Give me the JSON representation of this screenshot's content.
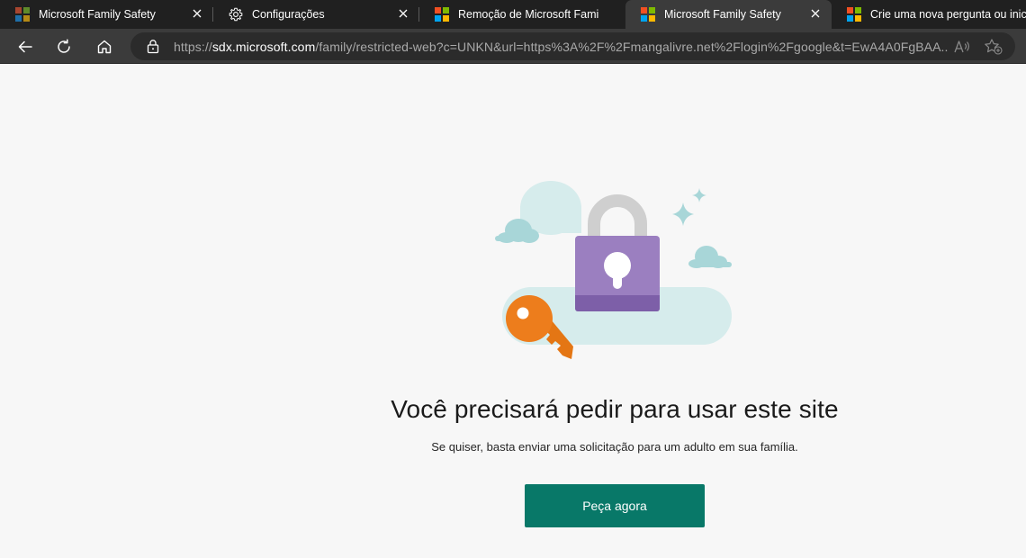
{
  "browser": {
    "tabs": [
      {
        "title": "Microsoft Family Safety",
        "icon": "microsoft-logo-icon",
        "active": false
      },
      {
        "title": "Configurações",
        "icon": "gear-icon",
        "active": false
      },
      {
        "title": "Remoção de Microsoft Family Safety",
        "icon": "microsoft-logo-icon",
        "active": false
      },
      {
        "title": "Microsoft Family Safety",
        "icon": "microsoft-logo-icon",
        "active": true
      },
      {
        "title": "Crie uma nova pergunta ou inicie uma discussão",
        "icon": "microsoft-logo-icon",
        "active": false
      }
    ],
    "address": {
      "scheme": "https://",
      "host": "sdx.microsoft.com",
      "rest": "/family/restricted-web?c=UNKN&url=https%3A%2F%2Fmangalivre.net%2Flogin%2Fgoogle&t=EwA4A0FgBAA..."
    }
  },
  "page": {
    "headline": "Você precisará pedir para usar este site",
    "subline": "Se quiser, basta enviar uma solicitação para um adulto em sua família.",
    "button_label": "Peça agora"
  },
  "colors": {
    "accent": "#087868",
    "lock_body": "#9b7fc0",
    "key": "#ed7d1c",
    "cloud": "#d5ecec"
  }
}
